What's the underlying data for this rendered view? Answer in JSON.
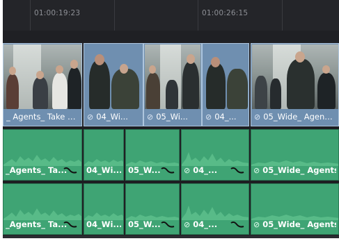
{
  "ruler": {
    "timecode_1": "01:00:19:23",
    "timecode_2": "01:00:26:15"
  },
  "video_clips": [
    {
      "label": "_ Agents_ Take 1...",
      "linked": false
    },
    {
      "label": "04_Wi...",
      "linked": true
    },
    {
      "label": "05_Wi...",
      "linked": true
    },
    {
      "label": "04_...",
      "linked": true
    },
    {
      "label": "05_Wide_ Agents_",
      "linked": true
    }
  ],
  "audio_track_1": [
    {
      "label": "_Agents_ Ta...",
      "linked": false
    },
    {
      "label": "04_Wi...",
      "linked": false
    },
    {
      "label": "05_W...",
      "linked": false
    },
    {
      "label": "04_...",
      "linked": true
    },
    {
      "label": "05_Wide_ Agents_",
      "linked": true
    }
  ],
  "audio_track_2": [
    {
      "label": "_Agents_ Ta...",
      "linked": false
    },
    {
      "label": "04_Wi...",
      "linked": false
    },
    {
      "label": "05_W...",
      "linked": false
    },
    {
      "label": "04_...",
      "linked": true
    },
    {
      "label": "05_Wide_ Agents_",
      "linked": true
    }
  ],
  "icons": {
    "link": "link-icon",
    "volume_curve": "volume-curve-icon"
  },
  "colors": {
    "video_clip": "#6f8fb0",
    "video_clip_border": "#aec6de",
    "audio_clip": "#3fa474",
    "timeline_bg": "#202024"
  }
}
